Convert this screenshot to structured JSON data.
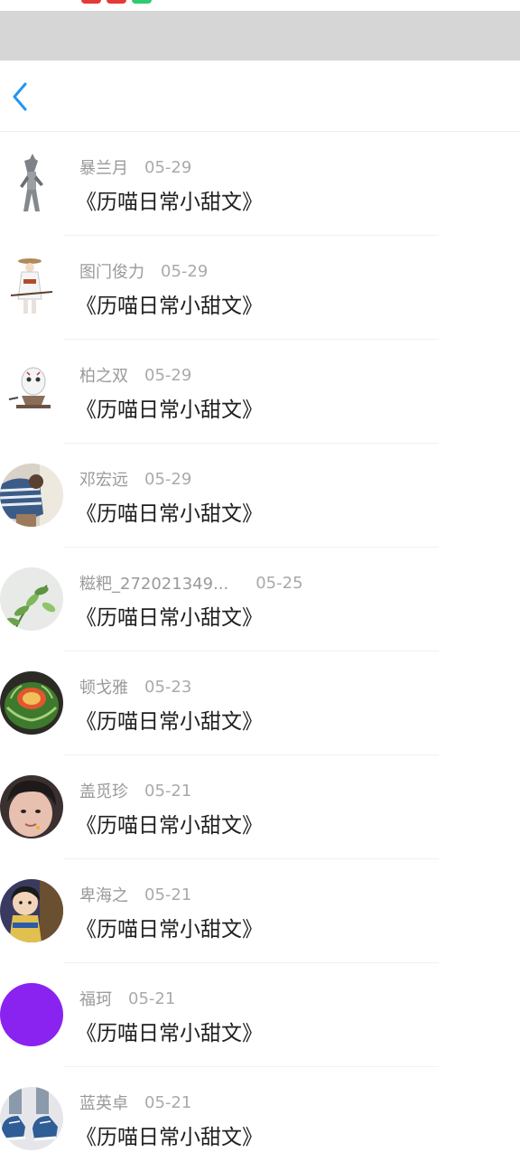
{
  "status_bar": {
    "indicator_colors": [
      "#e53935",
      "#e53935",
      "#2ecc71"
    ]
  },
  "nav": {
    "back_icon": "chevron-left-icon",
    "accent": "#2196f3"
  },
  "items": [
    {
      "name": "暴兰月",
      "date": "05-29",
      "title": "《历喵日常小甜文》",
      "avatar": "ultraman-figure"
    },
    {
      "name": "图门俊力",
      "date": "05-29",
      "title": "《历喵日常小甜文》",
      "avatar": "anime-girl-with-hat"
    },
    {
      "name": "柏之双",
      "date": "05-29",
      "title": "《历喵日常小甜文》",
      "avatar": "hockey-mask-figure"
    },
    {
      "name": "邓宏远",
      "date": "05-29",
      "title": "《历喵日常小甜文》",
      "avatar": "person-photo"
    },
    {
      "name": "糍粑_272021349...",
      "date": "05-25",
      "title": "《历喵日常小甜文》",
      "avatar": "plant-leaves"
    },
    {
      "name": "顿戈雅",
      "date": "05-23",
      "title": "《历喵日常小甜文》",
      "avatar": "carved-watermelon"
    },
    {
      "name": "盖觅珍",
      "date": "05-21",
      "title": "《历喵日常小甜文》",
      "avatar": "face-photo"
    },
    {
      "name": "卑海之",
      "date": "05-21",
      "title": "《历喵日常小甜文》",
      "avatar": "cartoon-character"
    },
    {
      "name": "福珂",
      "date": "05-21",
      "title": "《历喵日常小甜文》",
      "avatar": "purple-circle"
    },
    {
      "name": "蓝英卓",
      "date": "05-21",
      "title": "《历喵日常小甜文》",
      "avatar": "sneakers-photo"
    }
  ]
}
